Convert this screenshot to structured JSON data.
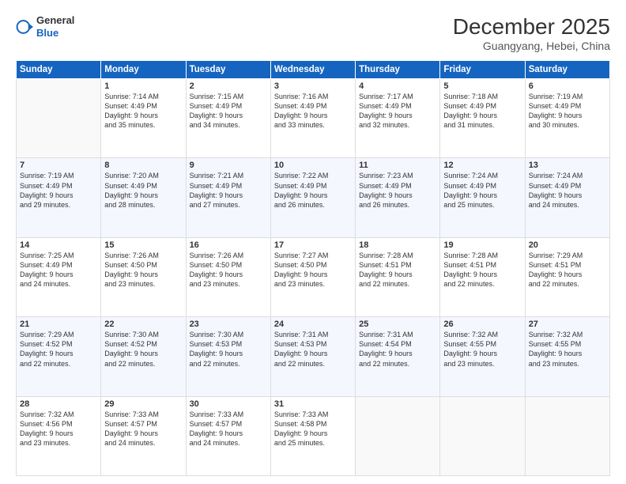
{
  "header": {
    "logo": {
      "general": "General",
      "blue": "Blue"
    },
    "title": "December 2025",
    "location": "Guangyang, Hebei, China"
  },
  "days_of_week": [
    "Sunday",
    "Monday",
    "Tuesday",
    "Wednesday",
    "Thursday",
    "Friday",
    "Saturday"
  ],
  "weeks": [
    [
      {
        "day": "",
        "sunrise": "",
        "sunset": "",
        "daylight": ""
      },
      {
        "day": "1",
        "sunrise": "7:14 AM",
        "sunset": "4:49 PM",
        "daylight": "9 hours and 35 minutes."
      },
      {
        "day": "2",
        "sunrise": "7:15 AM",
        "sunset": "4:49 PM",
        "daylight": "9 hours and 34 minutes."
      },
      {
        "day": "3",
        "sunrise": "7:16 AM",
        "sunset": "4:49 PM",
        "daylight": "9 hours and 33 minutes."
      },
      {
        "day": "4",
        "sunrise": "7:17 AM",
        "sunset": "4:49 PM",
        "daylight": "9 hours and 32 minutes."
      },
      {
        "day": "5",
        "sunrise": "7:18 AM",
        "sunset": "4:49 PM",
        "daylight": "9 hours and 31 minutes."
      },
      {
        "day": "6",
        "sunrise": "7:19 AM",
        "sunset": "4:49 PM",
        "daylight": "9 hours and 30 minutes."
      }
    ],
    [
      {
        "day": "7",
        "sunrise": "7:19 AM",
        "sunset": "4:49 PM",
        "daylight": "9 hours and 29 minutes."
      },
      {
        "day": "8",
        "sunrise": "7:20 AM",
        "sunset": "4:49 PM",
        "daylight": "9 hours and 28 minutes."
      },
      {
        "day": "9",
        "sunrise": "7:21 AM",
        "sunset": "4:49 PM",
        "daylight": "9 hours and 27 minutes."
      },
      {
        "day": "10",
        "sunrise": "7:22 AM",
        "sunset": "4:49 PM",
        "daylight": "9 hours and 26 minutes."
      },
      {
        "day": "11",
        "sunrise": "7:23 AM",
        "sunset": "4:49 PM",
        "daylight": "9 hours and 26 minutes."
      },
      {
        "day": "12",
        "sunrise": "7:24 AM",
        "sunset": "4:49 PM",
        "daylight": "9 hours and 25 minutes."
      },
      {
        "day": "13",
        "sunrise": "7:24 AM",
        "sunset": "4:49 PM",
        "daylight": "9 hours and 24 minutes."
      }
    ],
    [
      {
        "day": "14",
        "sunrise": "7:25 AM",
        "sunset": "4:49 PM",
        "daylight": "9 hours and 24 minutes."
      },
      {
        "day": "15",
        "sunrise": "7:26 AM",
        "sunset": "4:50 PM",
        "daylight": "9 hours and 23 minutes."
      },
      {
        "day": "16",
        "sunrise": "7:26 AM",
        "sunset": "4:50 PM",
        "daylight": "9 hours and 23 minutes."
      },
      {
        "day": "17",
        "sunrise": "7:27 AM",
        "sunset": "4:50 PM",
        "daylight": "9 hours and 23 minutes."
      },
      {
        "day": "18",
        "sunrise": "7:28 AM",
        "sunset": "4:51 PM",
        "daylight": "9 hours and 22 minutes."
      },
      {
        "day": "19",
        "sunrise": "7:28 AM",
        "sunset": "4:51 PM",
        "daylight": "9 hours and 22 minutes."
      },
      {
        "day": "20",
        "sunrise": "7:29 AM",
        "sunset": "4:51 PM",
        "daylight": "9 hours and 22 minutes."
      }
    ],
    [
      {
        "day": "21",
        "sunrise": "7:29 AM",
        "sunset": "4:52 PM",
        "daylight": "9 hours and 22 minutes."
      },
      {
        "day": "22",
        "sunrise": "7:30 AM",
        "sunset": "4:52 PM",
        "daylight": "9 hours and 22 minutes."
      },
      {
        "day": "23",
        "sunrise": "7:30 AM",
        "sunset": "4:53 PM",
        "daylight": "9 hours and 22 minutes."
      },
      {
        "day": "24",
        "sunrise": "7:31 AM",
        "sunset": "4:53 PM",
        "daylight": "9 hours and 22 minutes."
      },
      {
        "day": "25",
        "sunrise": "7:31 AM",
        "sunset": "4:54 PM",
        "daylight": "9 hours and 22 minutes."
      },
      {
        "day": "26",
        "sunrise": "7:32 AM",
        "sunset": "4:55 PM",
        "daylight": "9 hours and 23 minutes."
      },
      {
        "day": "27",
        "sunrise": "7:32 AM",
        "sunset": "4:55 PM",
        "daylight": "9 hours and 23 minutes."
      }
    ],
    [
      {
        "day": "28",
        "sunrise": "7:32 AM",
        "sunset": "4:56 PM",
        "daylight": "9 hours and 23 minutes."
      },
      {
        "day": "29",
        "sunrise": "7:33 AM",
        "sunset": "4:57 PM",
        "daylight": "9 hours and 24 minutes."
      },
      {
        "day": "30",
        "sunrise": "7:33 AM",
        "sunset": "4:57 PM",
        "daylight": "9 hours and 24 minutes."
      },
      {
        "day": "31",
        "sunrise": "7:33 AM",
        "sunset": "4:58 PM",
        "daylight": "9 hours and 25 minutes."
      },
      {
        "day": "",
        "sunrise": "",
        "sunset": "",
        "daylight": ""
      },
      {
        "day": "",
        "sunrise": "",
        "sunset": "",
        "daylight": ""
      },
      {
        "day": "",
        "sunrise": "",
        "sunset": "",
        "daylight": ""
      }
    ]
  ]
}
